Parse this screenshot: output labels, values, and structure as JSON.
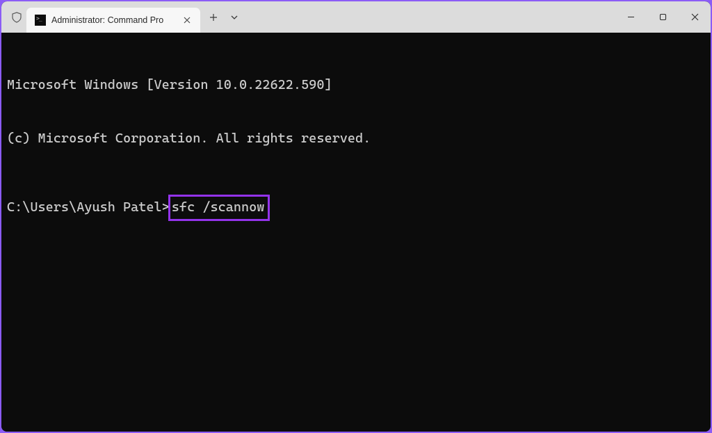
{
  "titlebar": {
    "tab_title": "Administrator: Command Pro"
  },
  "terminal": {
    "line1": "Microsoft Windows [Version 10.0.22622.590]",
    "line2": "(c) Microsoft Corporation. All rights reserved.",
    "prompt": "C:\\Users\\Ayush Patel>",
    "command": "sfc /scannow"
  },
  "highlight_color": "#9333ea"
}
